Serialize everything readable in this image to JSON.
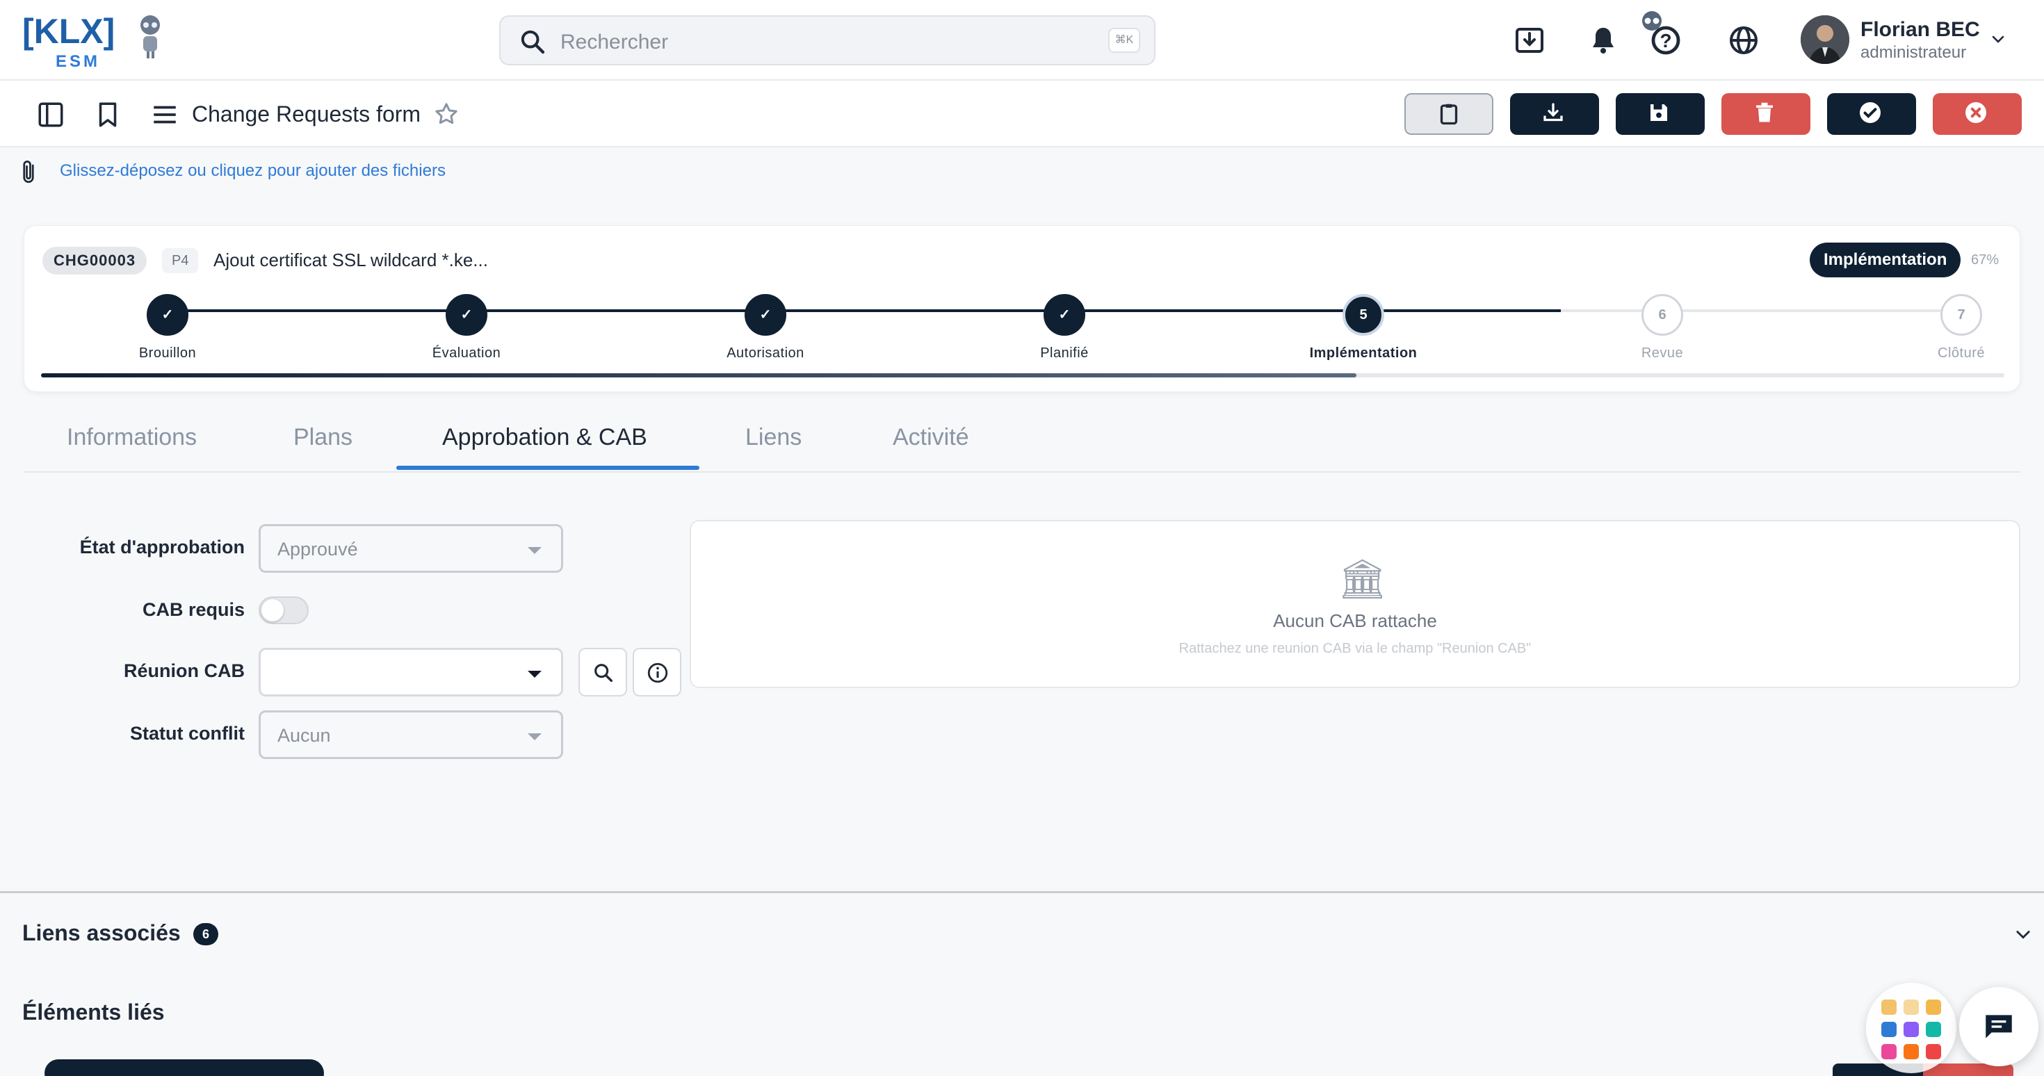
{
  "brand": {
    "logo_text": "[KLX]",
    "logo_sub": "ESM"
  },
  "search": {
    "placeholder": "Rechercher",
    "shortcut": "⌘K"
  },
  "user": {
    "name": "Florian BEC",
    "role": "administrateur"
  },
  "toolbar": {
    "form_title": "Change Requests form"
  },
  "dropzone": {
    "text": "Glissez-déposez ou cliquez pour ajouter des fichiers"
  },
  "record": {
    "id": "CHG00003",
    "priority": "P4",
    "title": "Ajout certificat SSL wildcard *.ke...",
    "state": "Implémentation",
    "progress_label": "67%",
    "progress": 0.67
  },
  "workflow": {
    "steps": [
      {
        "mark": "✓",
        "label": "Brouillon",
        "status": "done"
      },
      {
        "mark": "✓",
        "label": "Évaluation",
        "status": "done"
      },
      {
        "mark": "✓",
        "label": "Autorisation",
        "status": "done"
      },
      {
        "mark": "✓",
        "label": "Planifié",
        "status": "done"
      },
      {
        "mark": "5",
        "label": "Implémentation",
        "status": "current"
      },
      {
        "mark": "6",
        "label": "Revue",
        "status": "todo"
      },
      {
        "mark": "7",
        "label": "Clôturé",
        "status": "todo"
      }
    ]
  },
  "tabs": [
    {
      "label": "Informations"
    },
    {
      "label": "Plans"
    },
    {
      "label": "Approbation & CAB",
      "active": true
    },
    {
      "label": "Liens"
    },
    {
      "label": "Activité"
    }
  ],
  "form": {
    "approval_state_label": "État d'approbation",
    "approval_state_value": "Approuvé",
    "cab_required_label": "CAB requis",
    "cab_required": false,
    "cab_meeting_label": "Réunion CAB",
    "cab_meeting_value": "",
    "conflict_status_label": "Statut conflit",
    "conflict_status_value": "Aucun"
  },
  "cab_panel": {
    "icon": "🏛",
    "title": "Aucun CAB rattache",
    "subtitle": "Rattachez une reunion CAB via le champ \"Reunion CAB\""
  },
  "sections": {
    "associated_links_label": "Liens associés",
    "associated_links_count": "6",
    "linked_items_label": "Éléments liés"
  },
  "colors": {
    "navy": "#0f2033",
    "danger": "#d9534f",
    "accent": "#2e7bd6"
  }
}
